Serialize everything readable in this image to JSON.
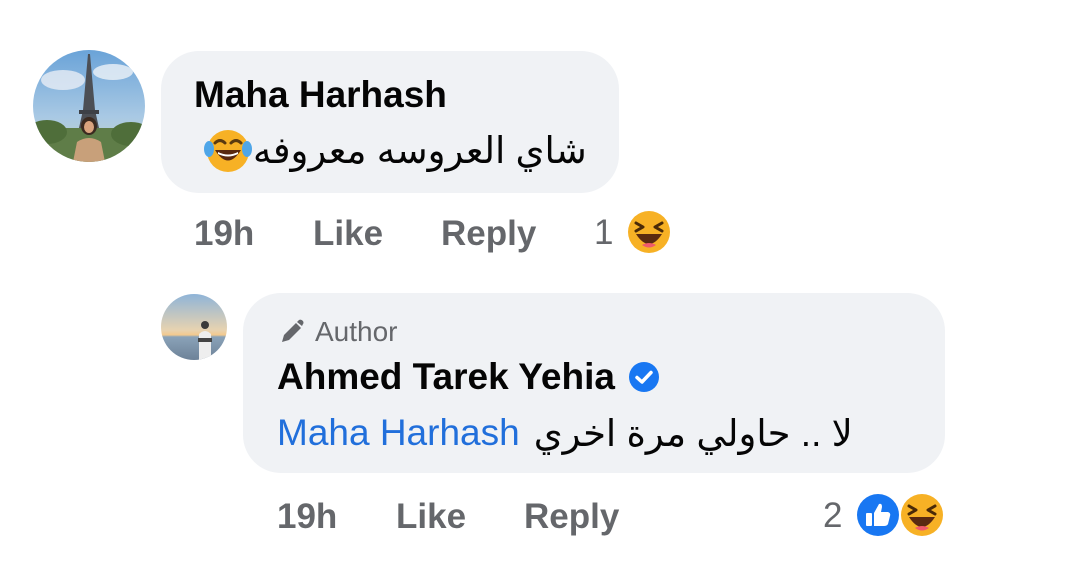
{
  "comment": {
    "author": "Maha Harhash",
    "text": "شاي العروسه معروفه",
    "emoji_icon": "laughing-tears-emoji",
    "time": "19h",
    "like_label": "Like",
    "reply_label": "Reply",
    "reaction_count": "1",
    "reaction_icons": [
      "haha-reaction"
    ]
  },
  "reply": {
    "badge_icon": "pencil-icon",
    "badge_label": "Author",
    "author": "Ahmed Tarek Yehia",
    "verified_icon": "verified-badge-icon",
    "mention": "Maha Harhash",
    "text": "لا .. حاولي مرة اخري",
    "time": "19h",
    "like_label": "Like",
    "reply_label": "Reply",
    "reaction_count": "2",
    "reaction_icons": [
      "like-reaction",
      "haha-reaction"
    ]
  },
  "colors": {
    "bubble": "#f0f2f5",
    "meta_text": "#65676b",
    "mention": "#216fdb",
    "verified": "#1877f2",
    "haha": "#f7b125"
  }
}
